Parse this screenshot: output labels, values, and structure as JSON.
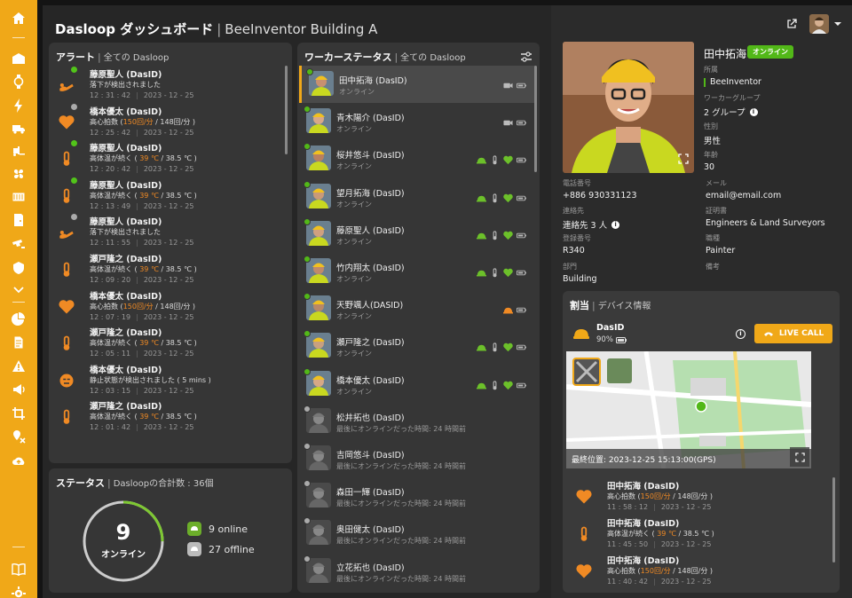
{
  "app": {
    "title_bold": "Dasloop ダッシュボード",
    "title_sep": "|",
    "title_sub": "BeeInventor Building A"
  },
  "sidebar": {
    "icons": [
      "home-icon",
      "building-icon",
      "watch-icon",
      "bolt-icon",
      "truck-icon",
      "forklift-icon",
      "fan-icon",
      "container-icon",
      "door-icon",
      "camera-icon",
      "shield-icon",
      "chevron-down-icon",
      "pie-chart-icon",
      "document-icon",
      "warning-icon",
      "megaphone-icon",
      "crop-icon",
      "map-pin-icon",
      "cloud-upload-icon",
      "book-icon",
      "gear-icon"
    ]
  },
  "alerts": {
    "title": "アラート",
    "sep": "|",
    "scope": "全ての Dasloop",
    "items": [
      {
        "name": "藤原聖人 (DasID)",
        "msg": "落下が検出されました",
        "hl": "",
        "msg2": "",
        "time": "12 : 31 : 42",
        "date": "2023 - 12 - 25",
        "icon": "fall-icon",
        "dot": "green"
      },
      {
        "name": "橋本優太 (DasID)",
        "msg": "高心拍数 (",
        "hl": "150回/分",
        "msg2": " / 148回/分 )",
        "time": "12 : 25 : 42",
        "date": "2023 - 12 - 25",
        "icon": "heart-icon",
        "dot": "grey"
      },
      {
        "name": "藤原聖人 (DasID)",
        "msg": "高体温が続く (",
        "hl": " 39 ℃",
        "msg2": " / 38.5 ℃ )",
        "time": "12 : 20 : 42",
        "date": "2023 - 12 - 25",
        "icon": "thermometer-icon",
        "dot": "green"
      },
      {
        "name": "藤原聖人 (DasID)",
        "msg": "高体温が続く (",
        "hl": " 39 ℃",
        "msg2": " / 38.5 ℃ )",
        "time": "12 : 13 : 49",
        "date": "2023 - 12 - 25",
        "icon": "thermometer-icon",
        "dot": "green"
      },
      {
        "name": "藤原聖人 (DasID)",
        "msg": "落下が検出されました",
        "hl": "",
        "msg2": "",
        "time": "12 : 11 : 55",
        "date": "2023 - 12 - 25",
        "icon": "fall-icon",
        "dot": "grey"
      },
      {
        "name": "瀬戸隆之 (DasID)",
        "msg": "高体温が続く (",
        "hl": " 39 ℃",
        "msg2": " / 38.5 ℃ )",
        "time": "12 : 09 : 20",
        "date": "2023 - 12 - 25",
        "icon": "thermometer-icon",
        "dot": ""
      },
      {
        "name": "橋本優太 (DasID)",
        "msg": "高心拍数 (",
        "hl": "150回/分",
        "msg2": " / 148回/分 )",
        "time": "12 : 07 : 19",
        "date": "2023 - 12 - 25",
        "icon": "heart-icon",
        "dot": ""
      },
      {
        "name": "瀬戸隆之 (DasID)",
        "msg": "高体温が続く (",
        "hl": " 39 ℃",
        "msg2": " / 38.5 ℃ )",
        "time": "12 : 05 : 11",
        "date": "2023 - 12 - 25",
        "icon": "thermometer-icon",
        "dot": ""
      },
      {
        "name": "橋本優太 (DasID)",
        "msg": "静止状態が検出されました ( 5 mins )",
        "hl": "",
        "msg2": "",
        "time": "12 : 03 : 15",
        "date": "2023 - 12 - 25",
        "icon": "still-face-icon",
        "dot": ""
      },
      {
        "name": "瀬戸隆之 (DasID)",
        "msg": "高体温が続く (",
        "hl": " 39 ℃",
        "msg2": " / 38.5 ℃ )",
        "time": "12 : 01 : 42",
        "date": "2023 - 12 - 25",
        "icon": "thermometer-icon",
        "dot": ""
      }
    ]
  },
  "status": {
    "title": "ステータス",
    "sep": "|",
    "sub": "Dasloopの合計数 : 36個",
    "online_count": "9",
    "online_label": "オンライン",
    "online_text": "9 online",
    "offline_text": "27 offline",
    "online_fraction": 0.25,
    "colors": {
      "online": "#7ec832",
      "offline": "#cccccc"
    }
  },
  "workers": {
    "title": "ワーカーステータス",
    "sep": "|",
    "scope": "全ての Dasloop",
    "items": [
      {
        "name": "田中拓海 (DasID)",
        "status": "オンライン",
        "online": true,
        "icons": [
          "camera-icon",
          "battery-icon"
        ],
        "selected": true
      },
      {
        "name": "青木陽介 (DasID)",
        "status": "オンライン",
        "online": true,
        "icons": [
          "camera-icon",
          "battery-icon"
        ]
      },
      {
        "name": "桜井悠斗 (DasID)",
        "status": "オンライン",
        "online": true,
        "icons": [
          "helmet-icon",
          "thermometer-icon",
          "heart-icon",
          "battery-icon"
        ]
      },
      {
        "name": "望月拓海 (DasID)",
        "status": "オンライン",
        "online": true,
        "icons": [
          "helmet-icon",
          "thermometer-icon",
          "heart-icon",
          "battery-icon"
        ]
      },
      {
        "name": "藤原聖人 (DasID)",
        "status": "オンライン",
        "online": true,
        "icons": [
          "helmet-icon",
          "thermometer-icon",
          "heart-icon",
          "battery-icon"
        ]
      },
      {
        "name": "竹内翔太 (DasID)",
        "status": "オンライン",
        "online": true,
        "icons": [
          "helmet-icon",
          "thermometer-icon",
          "heart-icon",
          "battery-icon"
        ]
      },
      {
        "name": "天野颯人(DASID)",
        "status": "オンライン",
        "online": true,
        "icons": [
          "helmet-icon",
          "battery-icon"
        ]
      },
      {
        "name": "瀬戸隆之 (DasID)",
        "status": "オンライン",
        "online": true,
        "icons": [
          "helmet-icon",
          "thermometer-icon",
          "heart-icon",
          "battery-icon"
        ]
      },
      {
        "name": "橋本優太 (DasID)",
        "status": "オンライン",
        "online": true,
        "icons": [
          "helmet-icon",
          "thermometer-icon",
          "heart-icon",
          "battery-icon"
        ]
      },
      {
        "name": "松井拓也 (DasID)",
        "status": "最後にオンラインだった時間: 24 時間前",
        "online": false,
        "icons": []
      },
      {
        "name": "吉岡悠斗 (DasID)",
        "status": "最後にオンラインだった時間: 24 時間前",
        "online": false,
        "icons": []
      },
      {
        "name": "森田一輝 (DasID)",
        "status": "最後にオンラインだった時間: 24 時間前",
        "online": false,
        "icons": []
      },
      {
        "name": "奥田健太 (DasID)",
        "status": "最後にオンラインだった時間: 24 時間前",
        "online": false,
        "icons": []
      },
      {
        "name": "立花拓也 (DasID)",
        "status": "最後にオンラインだった時間: 24 時間前",
        "online": false,
        "icons": []
      }
    ]
  },
  "profile": {
    "name": "田中拓海",
    "badge": "オンライン",
    "fields": {
      "org_label": "所属",
      "org_value": "BeeInventor",
      "group_label": "ワーカーグループ",
      "group_value": "2 グループ",
      "gender_label": "性別",
      "gender_value": "男性",
      "age_label": "年齢",
      "age_value": "30",
      "phone_label": "電話番号",
      "phone_value": "+886 930331123",
      "email_label": "メール",
      "email_value": "email@email.com",
      "contact_label": "連絡先",
      "contact_value": "連絡先 3 人",
      "cert_label": "証明書",
      "cert_value": "Engineers & Land Surveyors",
      "reg_label": "登録番号",
      "reg_value": "R340",
      "job_label": "職種",
      "job_value": "Painter",
      "dept_label": "部門",
      "dept_value": "Building",
      "note_label": "備考"
    }
  },
  "assignment": {
    "title": "割当",
    "sep": "|",
    "sub": "デバイス情報",
    "device_name": "DasID",
    "battery": "90%",
    "live_call": "LIVE CALL",
    "map_caption": "最終位置: 2023-12-25 15:13:00(GPS)",
    "alerts": [
      {
        "name": "田中拓海 (DasID)",
        "msg": "高心拍数 (",
        "hl": "150回/分",
        "msg2": " / 148回/分 )",
        "time": "11 : 58 : 12",
        "date": "2023 - 12 - 25",
        "icon": "heart-icon"
      },
      {
        "name": "田中拓海 (DasID)",
        "msg": "高体温が続く (",
        "hl": " 39 ℃",
        "msg2": " / 38.5 ℃ )",
        "time": "11 : 45 : 50",
        "date": "2023 - 12 - 25",
        "icon": "thermometer-icon"
      },
      {
        "name": "田中拓海 (DasID)",
        "msg": "高心拍数 (",
        "hl": "150回/分",
        "msg2": " / 148回/分 )",
        "time": "11 : 40 : 42",
        "date": "2023 - 12 - 25",
        "icon": "heart-icon"
      }
    ]
  },
  "colors": {
    "accent": "#f0a818",
    "alert": "#f08a24",
    "online": "#52b818"
  }
}
